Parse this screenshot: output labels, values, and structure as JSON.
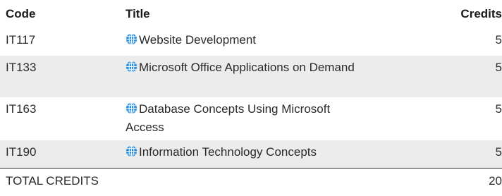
{
  "header": {
    "code": "Code",
    "title": "Title",
    "credits": "Credits"
  },
  "rows": [
    {
      "code": "IT117",
      "title": "Website Development",
      "credits": "5",
      "icon": "globe-icon"
    },
    {
      "code": "IT133",
      "title": "Microsoft Office Applications on Demand",
      "credits": "5",
      "icon": "globe-icon"
    },
    {
      "code": "IT163",
      "title": "Database Concepts Using Microsoft Access",
      "credits": "5",
      "icon": "globe-icon"
    },
    {
      "code": "IT190",
      "title": "Information Technology Concepts",
      "credits": "5",
      "icon": "globe-icon"
    }
  ],
  "total": {
    "label": "TOTAL CREDITS",
    "value": "20"
  },
  "colors": {
    "row_shade": "#ececec",
    "globe_fill": "#2f8fe0"
  }
}
